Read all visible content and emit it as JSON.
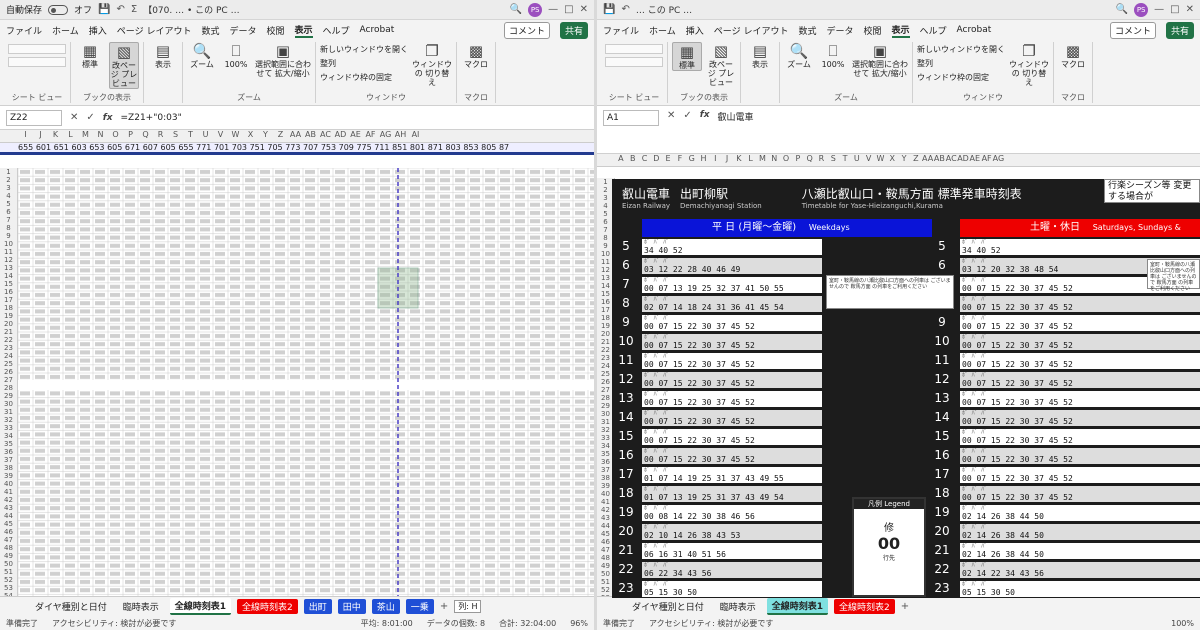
{
  "left": {
    "title": "【070. … • この PC …",
    "autosave": "自動保存",
    "autosave_state": "オフ",
    "avatar": "PS",
    "menu": [
      "ファイル",
      "ホーム",
      "挿入",
      "ページ レイアウト",
      "数式",
      "データ",
      "校閲",
      "表示",
      "ヘルプ",
      "Acrobat"
    ],
    "comment": "コメント",
    "share": "共有",
    "ribbon": {
      "sheet_view": "シート ビュー",
      "standard": "標準",
      "pagebreak": "改ページ プレビュー",
      "book_view": "ブックの表示",
      "show": "表示",
      "zoom": "ズーム",
      "zoom100": "100%",
      "fit": "選択範囲に合わせて 拡大/縮小",
      "zoom_group": "ズーム",
      "new_window": "新しいウィンドウを開く",
      "arrange": "整列",
      "freeze": "ウィンドウ枠の固定",
      "switch": "ウィンドウの 切り替え",
      "window_group": "ウィンドウ",
      "macro": "マクロ",
      "macro_group": "マクロ"
    },
    "namebox": "Z22",
    "formula": "=Z21+\"0:03\"",
    "cols": [
      "I",
      "J",
      "K",
      "L",
      "M",
      "N",
      "O",
      "P",
      "Q",
      "R",
      "S",
      "T",
      "U",
      "V",
      "W",
      "X",
      "Y",
      "Z",
      "AA",
      "AB",
      "AC",
      "AD",
      "AE",
      "AF",
      "AG",
      "AH",
      "AI"
    ],
    "trains": "655 601 651 603 653 605 671 607 605 655 771 701 703 751 705 773 707 753 709 775 711 851 801 871 803 853 805 87",
    "tabs": [
      "ダイヤ種別と日付",
      "臨時表示",
      "全線時刻表1",
      "全線時刻表2",
      "出町",
      "田中",
      "茶山",
      "一乗"
    ],
    "tooltip": "列: H",
    "status": {
      "ready": "準備完了",
      "access": "アクセシビリティ: 検討が必要です",
      "avg": "平均: 8:01:00",
      "count": "データの個数: 8",
      "sum": "合計: 32:04:00",
      "zoom": "96%"
    }
  },
  "right": {
    "title": "… この PC …",
    "avatar": "PS",
    "namebox": "A1",
    "formula": "叡山電車",
    "cols": [
      "A",
      "B",
      "C",
      "D",
      "E",
      "F",
      "G",
      "H",
      "I",
      "J",
      "K",
      "L",
      "M",
      "N",
      "O",
      "P",
      "Q",
      "R",
      "S",
      "T",
      "U",
      "V",
      "W",
      "X",
      "Y",
      "Z",
      "AA",
      "AB",
      "AC",
      "AD",
      "AE",
      "AF",
      "AG"
    ],
    "tabs": [
      "ダイヤ種別と日付",
      "臨時表示",
      "全線時刻表1",
      "全線時刻表2"
    ],
    "status": {
      "ready": "準備完了",
      "access": "アクセシビリティ: 検討が必要です",
      "zoom": "100%"
    }
  },
  "timetable": {
    "company": "叡山電車",
    "company_en": "Eizan Railway",
    "station": "出町柳駅",
    "station_en": "Demachiyanagi Station",
    "direction": "八瀬比叡山口・鞍馬方面 標準発車時刻表",
    "direction_en": "Timetable for Yase-Hieizanguchi,Kurama",
    "season": "行楽シーズン等 変更する場合が",
    "weekday": "平 日 (月曜〜金曜)",
    "weekday_en": "Weekdays",
    "holiday": "土曜・休日",
    "holiday_en": "Saturdays, Sundays &",
    "weekday_rows": [
      {
        "h": "5",
        "m": "34 40 52"
      },
      {
        "h": "6",
        "m": "03 12 22 28 40 46 49"
      },
      {
        "h": "7",
        "m": "00 07 13 19 25 32 37 41 50 55"
      },
      {
        "h": "8",
        "m": "02 07 14 18 24 31 36 41 45 54"
      },
      {
        "h": "9",
        "m": "00 07 15 22 30 37 45 52"
      },
      {
        "h": "10",
        "m": "00 07 15 22 30 37 45 52"
      },
      {
        "h": "11",
        "m": "00 07 15 22 30 37 45 52"
      },
      {
        "h": "12",
        "m": "00 07 15 22 30 37 45 52"
      },
      {
        "h": "13",
        "m": "00 07 15 22 30 37 45 52"
      },
      {
        "h": "14",
        "m": "00 07 15 22 30 37 45 52"
      },
      {
        "h": "15",
        "m": "00 07 15 22 30 37 45 52"
      },
      {
        "h": "16",
        "m": "00 07 15 22 30 37 45 52"
      },
      {
        "h": "17",
        "m": "01 07 14 19 25 31 37 43 49 55"
      },
      {
        "h": "18",
        "m": "01 07 13 19 25 31 37 43 49 54"
      },
      {
        "h": "19",
        "m": "00 08 14 22 30 38 46 56"
      },
      {
        "h": "20",
        "m": "02 10 14 26 38 43 53"
      },
      {
        "h": "21",
        "m": "06 16 31 40 51 56"
      },
      {
        "h": "22",
        "m": "06 22 34 43 56"
      },
      {
        "h": "23",
        "m": "05 15 30 50"
      }
    ],
    "holiday_rows": [
      {
        "h": "5",
        "m": "34 40 52"
      },
      {
        "h": "6",
        "m": "03 12 20 32 38 48 54"
      },
      {
        "h": "7",
        "m": "00 07 15 22 30 37 45 52"
      },
      {
        "h": "8",
        "m": "00 07 15 22 30 37 45 52"
      },
      {
        "h": "9",
        "m": "00 07 15 22 30 37 45 52"
      },
      {
        "h": "10",
        "m": "00 07 15 22 30 37 45 52"
      },
      {
        "h": "11",
        "m": "00 07 15 22 30 37 45 52"
      },
      {
        "h": "12",
        "m": "00 07 15 22 30 37 45 52"
      },
      {
        "h": "13",
        "m": "00 07 15 22 30 37 45 52"
      },
      {
        "h": "14",
        "m": "00 07 15 22 30 37 45 52"
      },
      {
        "h": "15",
        "m": "00 07 15 22 30 37 45 52"
      },
      {
        "h": "16",
        "m": "00 07 15 22 30 37 45 52"
      },
      {
        "h": "17",
        "m": "00 07 15 22 30 37 45 52"
      },
      {
        "h": "18",
        "m": "00 07 15 22 30 37 45 52"
      },
      {
        "h": "19",
        "m": "02 14 26 38 44 50"
      },
      {
        "h": "20",
        "m": "02 14 26 38 44 50"
      },
      {
        "h": "21",
        "m": "02 14 26 38 44 50"
      },
      {
        "h": "22",
        "m": "02 14 22 34 43 56"
      },
      {
        "h": "23",
        "m": "05 15 30 50"
      }
    ],
    "train_mark": "ﾎﾞ ﾊﾞ ﾊﾞ",
    "note": "室町・鞍馬線の八瀬比叡山口方面への列車は ございませんので 鞍馬方面 の列車をご利用ください",
    "legend_title": "凡例 Legend",
    "legend_dest": "修",
    "legend_time": "00",
    "legend_label": "行先"
  }
}
